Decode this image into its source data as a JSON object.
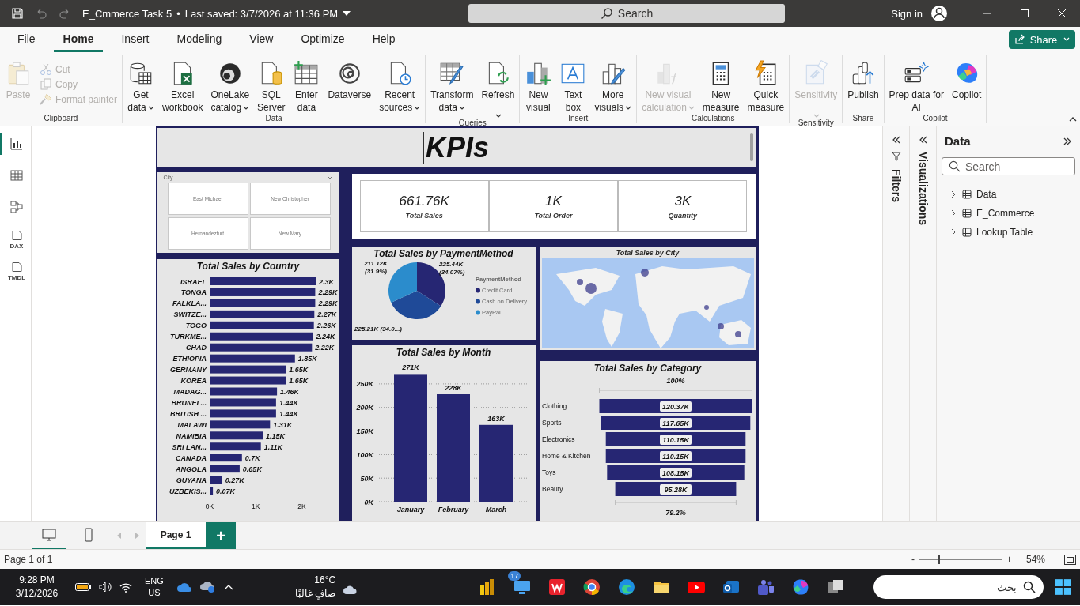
{
  "title_bar": {
    "file_name": "E_Cmmerce Task 5",
    "separator": "•",
    "saved": "Last saved: 3/7/2026 at 11:36 PM",
    "search_placeholder": "Search",
    "sign_in": "Sign in"
  },
  "menu_tabs": [
    {
      "label": "File",
      "selected": false
    },
    {
      "label": "Home",
      "selected": true
    },
    {
      "label": "Insert",
      "selected": false
    },
    {
      "label": "Modeling",
      "selected": false
    },
    {
      "label": "View",
      "selected": false
    },
    {
      "label": "Optimize",
      "selected": false
    },
    {
      "label": "Help",
      "selected": false
    }
  ],
  "share_button": "Share",
  "ribbon": [
    {
      "label": "Clipboard",
      "buttons": [
        {
          "label": "Paste",
          "kind": "large",
          "disabled": true,
          "dropdown": false
        },
        {
          "label": "Cut",
          "kind": "small",
          "disabled": true
        },
        {
          "label": "Copy",
          "kind": "small",
          "disabled": true
        },
        {
          "label": "Format painter",
          "kind": "small",
          "disabled": true
        }
      ]
    },
    {
      "label": "Data",
      "buttons": [
        {
          "label": "Get data",
          "kind": "large",
          "disabled": false,
          "dropdown": true
        },
        {
          "label": "Excel workbook",
          "kind": "large",
          "disabled": false,
          "dropdown": false
        },
        {
          "label": "OneLake catalog",
          "kind": "large",
          "disabled": false,
          "dropdown": true
        },
        {
          "label": "SQL Server",
          "kind": "large",
          "disabled": false,
          "dropdown": false
        },
        {
          "label": "Enter data",
          "kind": "large",
          "disabled": false,
          "dropdown": false
        },
        {
          "label": "Dataverse",
          "kind": "large",
          "disabled": false,
          "dropdown": false
        },
        {
          "label": "Recent sources",
          "kind": "large",
          "disabled": false,
          "dropdown": true
        }
      ]
    },
    {
      "label": "Queries",
      "buttons": [
        {
          "label": "Transform data",
          "kind": "large",
          "disabled": false,
          "dropdown": true
        },
        {
          "label": "Refresh",
          "kind": "large",
          "disabled": false,
          "dropdown": true
        }
      ]
    },
    {
      "label": "Insert",
      "buttons": [
        {
          "label": "New visual",
          "kind": "large",
          "disabled": false,
          "dropdown": false
        },
        {
          "label": "Text box",
          "kind": "large",
          "disabled": false,
          "dropdown": false
        },
        {
          "label": "More visuals",
          "kind": "large",
          "disabled": false,
          "dropdown": true
        }
      ]
    },
    {
      "label": "Calculations",
      "buttons": [
        {
          "label": "New visual calculation",
          "kind": "large",
          "disabled": true,
          "dropdown": true
        },
        {
          "label": "New measure",
          "kind": "large",
          "disabled": false,
          "dropdown": false
        },
        {
          "label": "Quick measure",
          "kind": "large",
          "disabled": false,
          "dropdown": false
        }
      ]
    },
    {
      "label": "Sensitivity",
      "buttons": [
        {
          "label": "Sensitivity",
          "kind": "large",
          "disabled": true,
          "dropdown": true
        }
      ]
    },
    {
      "label": "Share",
      "buttons": [
        {
          "label": "Publish",
          "kind": "large",
          "disabled": false,
          "dropdown": false
        }
      ]
    },
    {
      "label": "Copilot",
      "buttons": [
        {
          "label": "Prep data for AI",
          "kind": "large",
          "disabled": false,
          "dropdown": false
        },
        {
          "label": "Copilot",
          "kind": "large",
          "disabled": false,
          "dropdown": false
        }
      ]
    }
  ],
  "left_nav": [
    {
      "kind": "report",
      "selected": true
    },
    {
      "kind": "table",
      "selected": false
    },
    {
      "kind": "model",
      "selected": false
    },
    {
      "kind": "dax",
      "label": "DAX",
      "selected": false
    },
    {
      "kind": "tmdl",
      "label": "TMDL",
      "selected": false
    }
  ],
  "report": {
    "title": "KPIs",
    "slicer": {
      "title": "City",
      "items": [
        {
          "label": "East Michael",
          "selected": false
        },
        {
          "label": "New Christopher",
          "selected": false
        },
        {
          "label": "Hernandezfurt",
          "selected": false
        },
        {
          "label": "New Mary",
          "selected": false
        }
      ]
    },
    "kpis": [
      {
        "value": "661.76K",
        "label": "Total Sales"
      },
      {
        "value": "1K",
        "label": "Total Order"
      },
      {
        "value": "3K",
        "label": "Quantity"
      }
    ],
    "country_chart": {
      "chart_data": {
        "type": "bar",
        "orientation": "horizontal",
        "title": "Total Sales by Country",
        "categories": [
          "ISRAEL",
          "TONGA",
          "FALKLA...",
          "SWITZE...",
          "TOGO",
          "TURKME...",
          "CHAD",
          "ETHIOPIA",
          "GERMANY",
          "KOREA",
          "MADAG...",
          "BRUNEI ...",
          "BRITISH ...",
          "MALAWI",
          "NAMIBIA",
          "SRI LAN...",
          "CANADA",
          "ANGOLA",
          "GUYANA",
          "UZBEKIS..."
        ],
        "series": [
          {
            "color": "#262673",
            "values": [
              2300,
              2290,
              2290,
              2270,
              2260,
              2240,
              2220,
              1850,
              1650,
              1650,
              1460,
              1440,
              1440,
              1310,
              1150,
              1110,
              700,
              650,
              270,
              70
            ]
          }
        ],
        "value_labels": [
          "2.3K",
          "2.29K",
          "2.29K",
          "2.27K",
          "2.26K",
          "2.24K",
          "2.22K",
          "1.85K",
          "1.65K",
          "1.65K",
          "1.46K",
          "1.44K",
          "1.44K",
          "1.31K",
          "1.15K",
          "1.11K",
          "0.7K",
          "0.65K",
          "0.27K",
          "0.07K"
        ],
        "xlim": [
          0,
          2300
        ],
        "xticks": [
          {
            "value": 0,
            "label": "0K"
          },
          {
            "value": 1000,
            "label": "1K"
          },
          {
            "value": 2000,
            "label": "2K"
          }
        ]
      }
    },
    "payment_chart": {
      "chart_data": {
        "type": "pie",
        "title": "Total Sales by PaymentMethod",
        "categories": [
          "Credit Card",
          "Cash on Delivery",
          "PayPal"
        ],
        "colors": [
          "#262673",
          "#1f4a98",
          "#2b8ccc"
        ],
        "series": [
          {
            "values": [
              34.07,
              34.03,
              31.9
            ]
          }
        ],
        "value_labels": [
          "225.44K (34.07%)",
          "225.21K (34.0...)",
          "211.12K (31.9%)"
        ],
        "legend": {
          "title": "PaymentMethod"
        }
      }
    },
    "map": {
      "title": "Total Sales by City",
      "kind": "picture"
    },
    "month_chart": {
      "chart_data": {
        "type": "bar",
        "title": "Total Sales by Month",
        "categories": [
          "January",
          "February",
          "March"
        ],
        "series": [
          {
            "color": "#262673",
            "values": [
              271000,
              228000,
              163000
            ]
          }
        ],
        "value_labels": [
          "271K",
          "228K",
          "163K"
        ],
        "grid": true,
        "ylim": [
          0,
          275000
        ],
        "yticks": [
          {
            "value": 0,
            "label": "0K"
          },
          {
            "value": 50000,
            "label": "50K"
          },
          {
            "value": 100000,
            "label": "100K"
          },
          {
            "value": 150000,
            "label": "150K"
          },
          {
            "value": 200000,
            "label": "200K"
          },
          {
            "value": 250000,
            "label": "250K"
          }
        ]
      }
    },
    "category_chart": {
      "title": "Total Sales by Category",
      "top_label": "100%",
      "bottom_label": "79.2%",
      "rows": [
        {
          "label": "Clothing",
          "value": "120.37K"
        },
        {
          "label": "Sports",
          "value": "117.65K"
        },
        {
          "label": "Electronics",
          "value": "110.15K"
        },
        {
          "label": "Home & Kitchen",
          "value": "110.15K"
        },
        {
          "label": "Toys",
          "value": "108.15K"
        },
        {
          "label": "Beauty",
          "value": "95.28K"
        }
      ]
    }
  },
  "filters_pane": {
    "title": "Filters"
  },
  "visualizations_pane": {
    "title": "Visualizations"
  },
  "data_pane": {
    "title": "Data",
    "search_placeholder": "Search",
    "tables": [
      {
        "label": "Data",
        "expanded": false
      },
      {
        "label": "E_Commerce",
        "expanded": false
      },
      {
        "label": "Lookup Table",
        "expanded": false
      }
    ]
  },
  "view_buttons": [
    {
      "kind": "desktop",
      "selected": true
    },
    {
      "kind": "mobile",
      "selected": false
    }
  ],
  "pages": [
    {
      "label": "Page 1",
      "selected": true
    }
  ],
  "add_page": "+",
  "status_bar": {
    "page_info": "Page 1 of 1",
    "zoom_out": "-",
    "zoom_in": "+",
    "zoom": "54%",
    "zoom_level": {
      "level": 0.22
    }
  },
  "taskbar": {
    "time": "9:28 PM",
    "date": "3/12/2026",
    "language": "ENG",
    "region": "US",
    "temperature": "16°C",
    "weather": "صافٍ غالبًا",
    "badge": "17",
    "search_placeholder": "بحث"
  }
}
